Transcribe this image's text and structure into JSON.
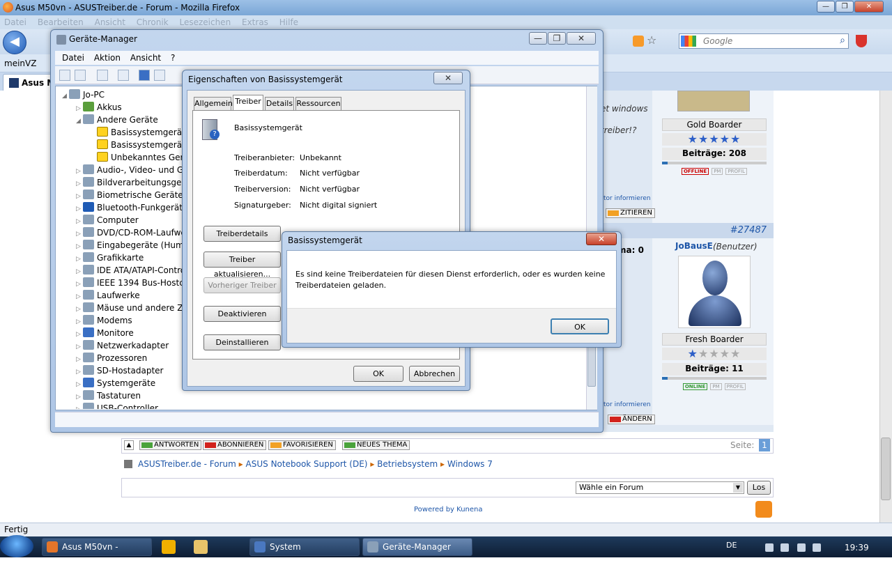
{
  "firefox": {
    "title": "Asus M50vn - ASUSTreiber.de - Forum - Mozilla Firefox",
    "menu": [
      "Datei",
      "Bearbeiten",
      "Ansicht",
      "Chronik",
      "Lesezeichen",
      "Extras",
      "Hilfe"
    ],
    "bookmark": "meinVZ",
    "tab_label": "Asus M",
    "search_placeholder": "Google",
    "status": "Fertig"
  },
  "forum": {
    "snippet1": "et windows",
    "snippet2": "treiber!?",
    "user1_rank": "Gold Boarder",
    "user1_posts": "Beiträge: 208",
    "user1_posts_fraction": 0.05,
    "user1_stars": 5,
    "moderator_link1": "tor informieren",
    "cite_btn": "ZITIEREN",
    "post_number": "#27487",
    "thema_snippet": "ma: 0",
    "user2_name": "JoBausE",
    "user2_role": "(Benutzer)",
    "user2_rank": "Fresh Boarder",
    "user2_posts": "Beiträge: 11",
    "user2_posts_fraction": 0.05,
    "user2_stars": 1,
    "moderator_link2": "tor informieren",
    "edit_btn": "ÄNDERN",
    "badge_offline": "OFFLINE",
    "badge_online": "ONLINE",
    "badge_pm": "PM",
    "badge_profil": "PROFIL",
    "bottom_buttons": [
      "ANTWORTEN",
      "ABONNIEREN",
      "FAVORISIEREN",
      "NEUES THEMA"
    ],
    "page_label": "Seite:",
    "page_num": "1",
    "breadcrumb": [
      "ASUSTreiber.de - Forum",
      "ASUS Notebook Support (DE)",
      "Betriebsystem",
      "Windows 7"
    ],
    "select_forum": "Wähle ein Forum",
    "go_btn": "Los",
    "powered": "Powered by Kunena"
  },
  "device_manager": {
    "title": "Geräte-Manager",
    "menu": [
      "Datei",
      "Aktion",
      "Ansicht",
      "?"
    ],
    "root": "Jo-PC",
    "nodes": [
      "Akkus",
      "Andere Geräte",
      "Basissystemgerät",
      "Basissystemgerät",
      "Unbekanntes Gerät",
      "Audio-, Video- und Ga",
      "Bildverarbeitungsgerät",
      "Biometrische Geräte",
      "Bluetooth-Funkgerät",
      "Computer",
      "DVD/CD-ROM-Laufwe",
      "Eingabegeräte (Human",
      "Grafikkarte",
      "IDE ATA/ATAPI-Contro",
      "IEEE 1394 Bus-Hostcon",
      "Laufwerke",
      "Mäuse und andere Zei",
      "Modems",
      "Monitore",
      "Netzwerkadapter",
      "Prozessoren",
      "SD-Hostadapter",
      "Systemgeräte",
      "Tastaturen",
      "USB-Controller"
    ]
  },
  "properties": {
    "title": "Eigenschaften von Basissystemgerät",
    "tabs": [
      "Allgemein",
      "Treiber",
      "Details",
      "Ressourcen"
    ],
    "device_name": "Basissystemgerät",
    "rows": [
      {
        "label": "Treiberanbieter:",
        "value": "Unbekannt"
      },
      {
        "label": "Treiberdatum:",
        "value": "Nicht verfügbar"
      },
      {
        "label": "Treiberversion:",
        "value": "Nicht verfügbar"
      },
      {
        "label": "Signaturgeber:",
        "value": "Nicht digital signiert"
      }
    ],
    "buttons": [
      "Treiberdetails",
      "Treiber aktualisieren...",
      "Vorheriger Treiber",
      "Deaktivieren",
      "Deinstallieren"
    ],
    "ok": "OK",
    "cancel": "Abbrechen"
  },
  "message": {
    "title": "Basissystemgerät",
    "text": "Es sind keine Treiberdateien für diesen Dienst erforderlich, oder es wurden keine Treiberdateien geladen.",
    "ok": "OK"
  },
  "taskbar": {
    "tasks": [
      "Asus M50vn - ASUST...",
      "System",
      "Geräte-Manager"
    ],
    "lang": "DE",
    "time": "19:39"
  }
}
